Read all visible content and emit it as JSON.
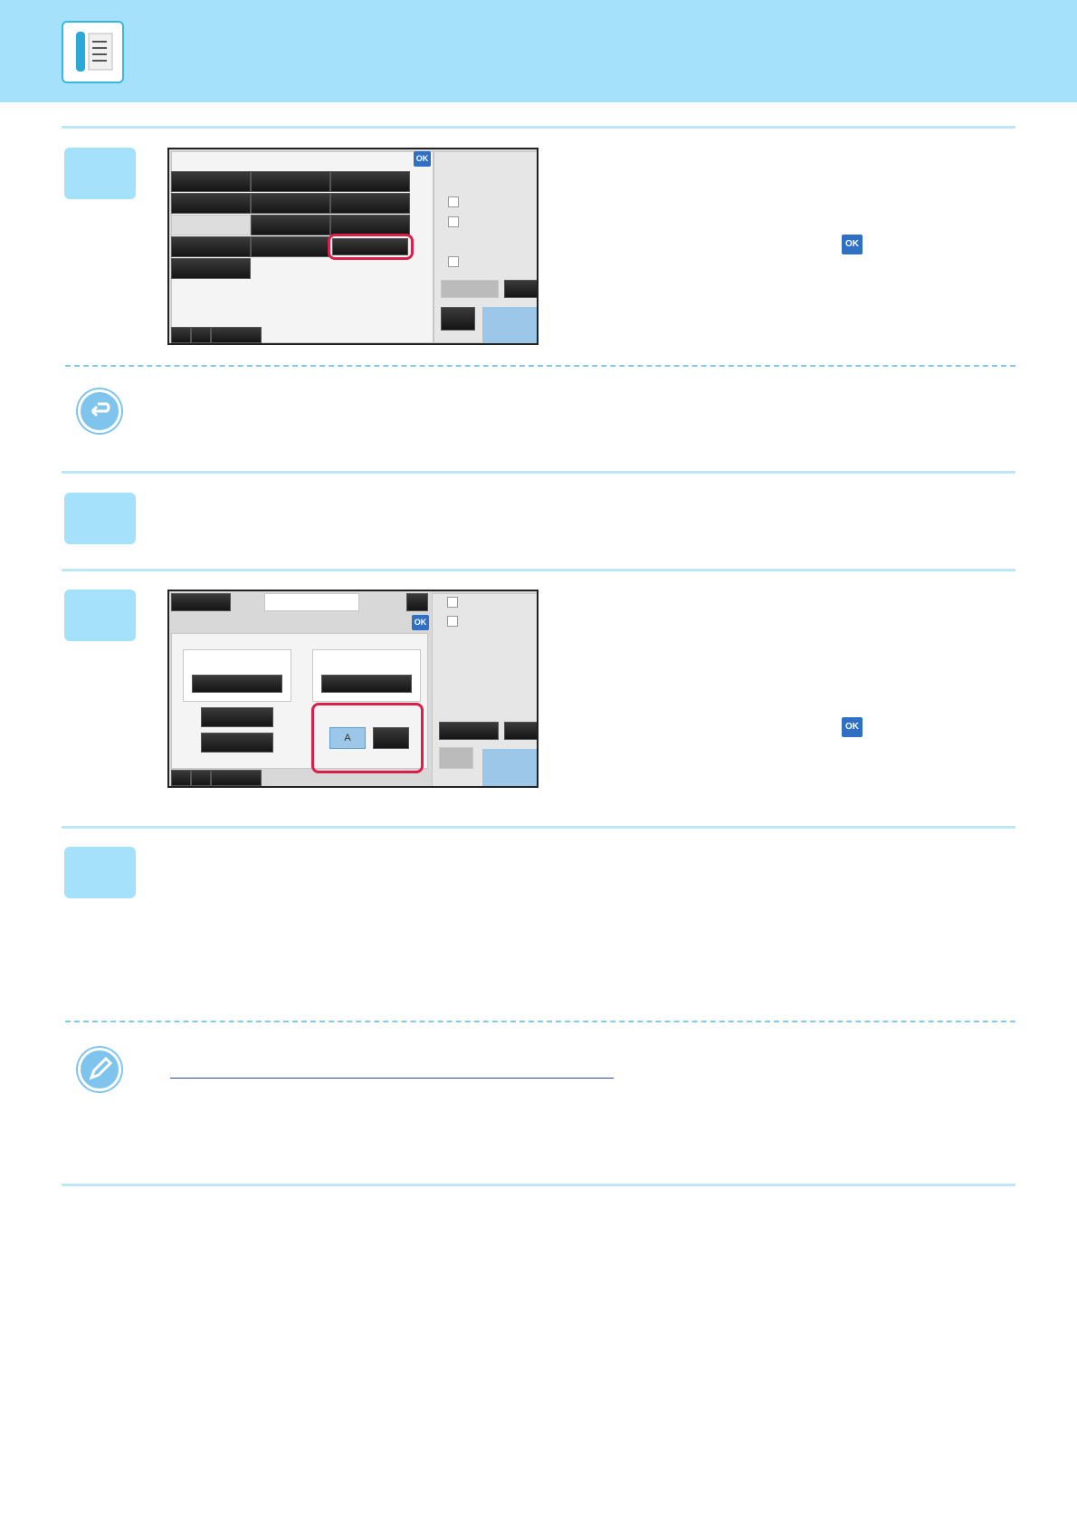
{
  "header": {
    "icon": "fax-document-icon",
    "background": "#a6e1fb"
  },
  "screen1": {
    "ok_label": "OK"
  },
  "screen2": {
    "ok_label": "OK",
    "text_mode_label": "A"
  },
  "inline_ok": {
    "label": "OK"
  }
}
